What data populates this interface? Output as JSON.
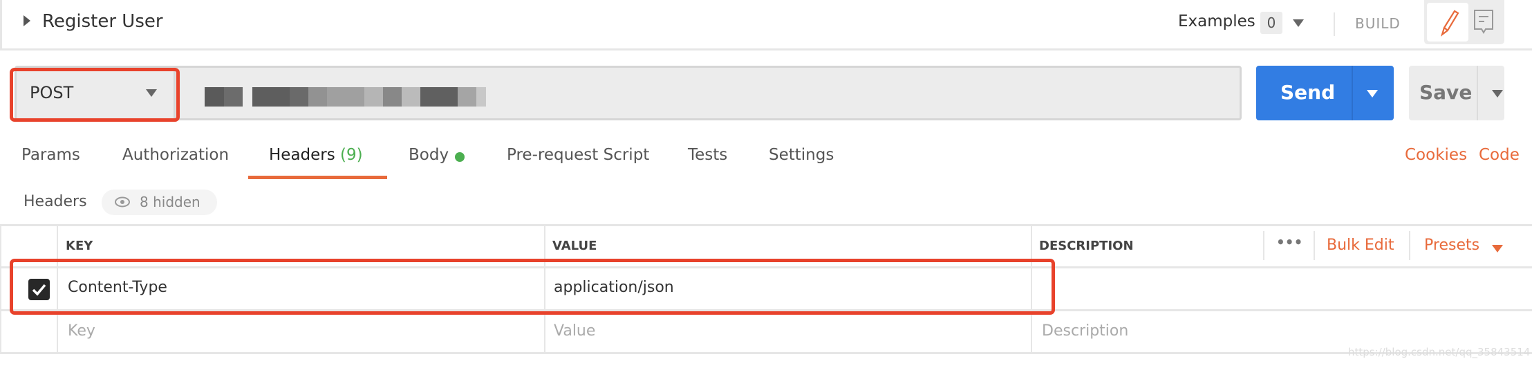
{
  "request": {
    "title": "Register User",
    "method": "POST",
    "url_obscured": true
  },
  "topbar": {
    "examples_label": "Examples",
    "examples_count": "0",
    "build_label": "BUILD",
    "icons": [
      "pencil-icon",
      "comment-icon"
    ]
  },
  "actions": {
    "send_label": "Send",
    "save_label": "Save"
  },
  "tabs": [
    {
      "label": "Params"
    },
    {
      "label": "Authorization"
    },
    {
      "label": "Headers",
      "count": "(9)",
      "active": true
    },
    {
      "label": "Body",
      "indicator": "green-dot"
    },
    {
      "label": "Pre-request Script"
    },
    {
      "label": "Tests"
    },
    {
      "label": "Settings"
    }
  ],
  "links": {
    "cookies": "Cookies",
    "code": "Code"
  },
  "headers_section": {
    "label": "Headers",
    "hidden_label": "8 hidden"
  },
  "table": {
    "columns": [
      "KEY",
      "VALUE",
      "DESCRIPTION"
    ],
    "more_label": "•••",
    "bulk_edit": "Bulk Edit",
    "presets": "Presets",
    "rows": [
      {
        "checked": true,
        "key": "Content-Type",
        "value": "application/json",
        "description": ""
      }
    ],
    "placeholders": {
      "key": "Key",
      "value": "Value",
      "description": "Description"
    }
  },
  "colors": {
    "accent": "#e86a3b",
    "send": "#327de3",
    "highlight": "#e8422b",
    "success": "#4caf50"
  },
  "watermark": "https://blog.csdn.net/qq_35843514"
}
